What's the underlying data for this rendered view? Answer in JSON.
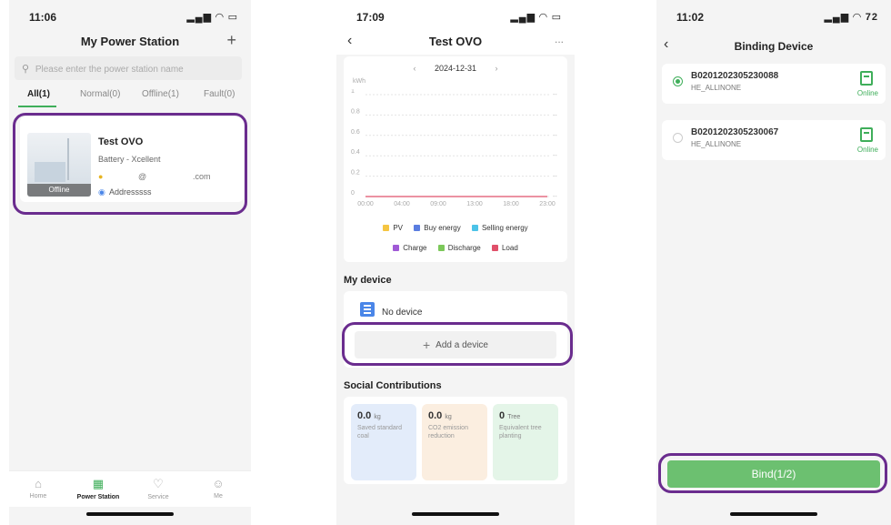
{
  "colors": {
    "accent": "#3fae5a",
    "highlight": "#6a2c8e",
    "bind_button": "#6cc070"
  },
  "screen1": {
    "status_time": "11:06",
    "title": "My Power Station",
    "add_icon": "plus-icon",
    "search_placeholder": "Please enter the power station name",
    "tabs": [
      {
        "label": "All(1)",
        "active": true
      },
      {
        "label": "Normal(0)"
      },
      {
        "label": "Offline(1)"
      },
      {
        "label": "Fault(0)"
      }
    ],
    "station": {
      "name": "Test OVO",
      "type": "Battery - Xcellent",
      "email_at": "@",
      "email_domain": ".com",
      "address": "Addresssss",
      "status": "Offline"
    },
    "nav": [
      {
        "label": "Home",
        "icon": "home-icon"
      },
      {
        "label": "Power Station",
        "icon": "grid-icon",
        "active": true
      },
      {
        "label": "Service",
        "icon": "heart-icon"
      },
      {
        "label": "Me",
        "icon": "user-icon"
      }
    ]
  },
  "screen2": {
    "status_time": "17:09",
    "title": "Test OVO",
    "more": "...",
    "date": "2024-12-31",
    "prev": "‹",
    "next": "›",
    "unit": "kWh",
    "chart_data": {
      "type": "line",
      "x": [
        "00:00",
        "04:00",
        "09:00",
        "13:00",
        "18:00",
        "23:00"
      ],
      "yticks": [
        "0",
        "0.2",
        "0.4",
        "0.6",
        "0.8",
        "1"
      ],
      "ylim": [
        0,
        1
      ],
      "ylabel": "kWh",
      "series": [
        {
          "name": "PV",
          "color": "#f5c542",
          "values": []
        },
        {
          "name": "Buy energy",
          "color": "#5a7de0",
          "values": []
        },
        {
          "name": "Selling energy",
          "color": "#4cc3e8",
          "values": []
        },
        {
          "name": "Charge",
          "color": "#a05ad6",
          "values": []
        },
        {
          "name": "Discharge",
          "color": "#7cc85a",
          "values": []
        },
        {
          "name": "Load",
          "color": "#e0506a",
          "values": [
            0,
            0,
            0,
            0,
            0,
            0
          ]
        }
      ]
    },
    "my_device_title": "My device",
    "no_device": "No device",
    "add_device": "Add a device",
    "social_title": "Social Contributions",
    "contributions": [
      {
        "value": "0.0",
        "unit": "kg",
        "label": "Saved standard coal",
        "bg": "#e3ecfa"
      },
      {
        "value": "0.0",
        "unit": "kg",
        "label": "CO2 emission reduction",
        "bg": "#fbeee0"
      },
      {
        "value": "0",
        "unit": "Tree",
        "label": "Equivalent tree planting",
        "bg": "#e4f5e8"
      }
    ]
  },
  "screen3": {
    "status_time": "11:02",
    "battery": "72",
    "title": "Binding Device",
    "devices": [
      {
        "sn": "B0201202305230088",
        "model": "HE_ALLINONE",
        "status": "Online",
        "selected": true
      },
      {
        "sn": "B0201202305230067",
        "model": "HE_ALLINONE",
        "status": "Online",
        "selected": false
      }
    ],
    "bind_label": "Bind(1/2)"
  }
}
